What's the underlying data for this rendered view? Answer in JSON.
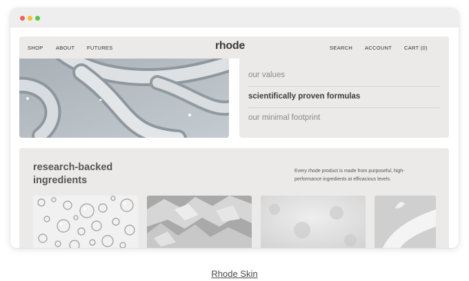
{
  "nav": {
    "left_links": [
      "SHOP",
      "ABOUT",
      "FUTURES"
    ],
    "logo": "rhode",
    "right_links": [
      "SEARCH",
      "ACCOUNT",
      "CART (0)"
    ]
  },
  "hero": {
    "image": "product-swirl-image"
  },
  "values": {
    "items": [
      "our values",
      "scientifically proven formulas",
      "our minimal footprint"
    ],
    "active_index": 1
  },
  "ingredients": {
    "title": "research-backed ingredients",
    "description": "Every rhode product is made from purposeful, high-performance ingredients at efficacious levels.",
    "photos": [
      "bubbles-image",
      "crystals-image",
      "powder-image",
      "cream-smear-image"
    ]
  },
  "caption": "Rhode Skin",
  "colors": {
    "panel": "#ebeae8",
    "window_bar": "#eeeeee",
    "dot_red": "#f25f58",
    "dot_yellow": "#fbbe2e",
    "dot_green": "#58c840"
  }
}
